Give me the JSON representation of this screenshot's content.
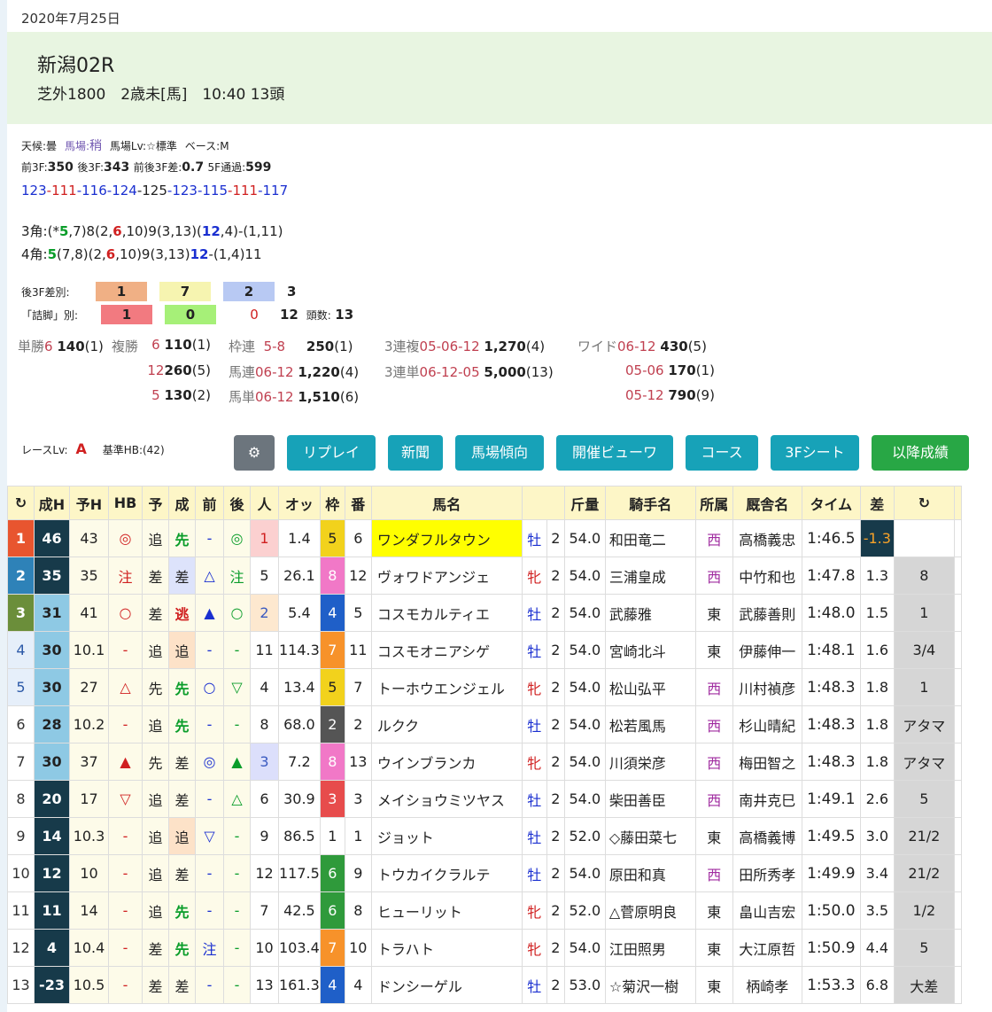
{
  "race": {
    "date": "2020年7月25日",
    "venue": "新潟02R",
    "conditions": "芝外1800　2歳未[馬]　10:40 13頭"
  },
  "track": {
    "weather": "天候:曇",
    "going_label": "馬場:",
    "going": "稍",
    "level": "馬場Lv:☆標準",
    "pace": "ベース:M",
    "front3f_label": "前3F:",
    "front3f": "350",
    "back3f_label": "後3F:",
    "back3f": "343",
    "diff_label": "前後3F差:",
    "diff": "0.7",
    "pass5f_label": "5F通過:",
    "pass5f": "599",
    "laps": [
      "123",
      "111",
      "116",
      "124",
      "125",
      "123",
      "115",
      "111",
      "117"
    ]
  },
  "corners": {
    "c3_prefix": "3角:(*",
    "c3_a": "5",
    "c3_b": ",7)8(2,",
    "c3_c": "6",
    "c3_d": ",10)9(3,13)(",
    "c3_e": "12",
    "c3_f": ",4)-(1,11)",
    "c4_prefix": "4角:",
    "c4_a": "5",
    "c4_b": "(7,8)(2,",
    "c4_c": "6",
    "c4_d": ",10)9(3,13)",
    "c4_e": "12",
    "c4_f": "-(1,4)11"
  },
  "splits": {
    "label1": "後3F差別:",
    "v1": "1",
    "v2": "7",
    "v3": "2",
    "v4": "3",
    "label2": "「詰脚」別:",
    "w1": "1",
    "w2": "0",
    "w3": "0",
    "w4": "12",
    "count_label": "頭数:",
    "count": "13"
  },
  "payouts": {
    "win_label": "単勝",
    "win_no": "6",
    "win_amt": "140",
    "win_pop": "(1)",
    "place_label": "複勝",
    "p1_no": "6",
    "p1_amt": "110",
    "p1_pop": "(1)",
    "p2_no": "12",
    "p2_amt": "260",
    "p2_pop": "(5)",
    "p3_no": "5",
    "p3_amt": "130",
    "p3_pop": "(2)",
    "wakuren_label": "枠連",
    "wakuren_no": "5-8",
    "wakuren_amt": "250",
    "wakuren_pop": "(1)",
    "umaren_label": "馬連",
    "umaren_no": "06-12",
    "umaren_amt": "1,220",
    "umaren_pop": "(4)",
    "umatan_label": "馬単",
    "umatan_no": "06-12",
    "umatan_amt": "1,510",
    "umatan_pop": "(6)",
    "trio_label": "3連複",
    "trio_no": "05-06-12",
    "trio_amt": "1,270",
    "trio_pop": "(4)",
    "tri_label": "3連単",
    "tri_no": "06-12-05",
    "tri_amt": "5,000",
    "tri_pop": "(13)",
    "wide_label": "ワイド",
    "w1_no": "06-12",
    "w1_amt": "430",
    "w1_pop": "(5)",
    "w2_no": "05-06",
    "w2_amt": "170",
    "w2_pop": "(1)",
    "w3_no": "05-12",
    "w3_amt": "790",
    "w3_pop": "(9)"
  },
  "level": {
    "label": "レースLv:",
    "value": "A",
    "hb_label": "基準HB:(42)"
  },
  "buttons": {
    "replay": "リプレイ",
    "paper": "新聞",
    "going": "馬場傾向",
    "view": "開催ビューワ",
    "course": "コース",
    "sheet": "3Fシート",
    "after": "以降成績"
  },
  "headers": [
    "成H",
    "予H",
    "HB",
    "予",
    "成",
    "前",
    "後",
    "人",
    "オッ",
    "枠",
    "番",
    "馬名",
    "",
    "斤量",
    "騎手名",
    "所属",
    "厩舎名",
    "タイム",
    "差"
  ],
  "rows": [
    [
      "1",
      "46",
      "43",
      "◎",
      "追",
      "先",
      "-",
      "◎",
      "1",
      "1.4",
      "5",
      "6",
      "ワンダフルタウン",
      "牡",
      "2",
      "54.0",
      "和田竜二",
      "西",
      "高橋義忠",
      "1:46.5",
      "-1.3",
      ""
    ],
    [
      "2",
      "35",
      "35",
      "注",
      "差",
      "差",
      "△",
      "注",
      "5",
      "26.1",
      "8",
      "12",
      "ヴォワドアンジェ",
      "牝",
      "2",
      "54.0",
      "三浦皇成",
      "西",
      "中竹和也",
      "1:47.8",
      "1.3",
      "8"
    ],
    [
      "3",
      "31",
      "41",
      "○",
      "差",
      "逃",
      "▲",
      "○",
      "2",
      "5.4",
      "4",
      "5",
      "コスモカルティエ",
      "牡",
      "2",
      "54.0",
      "武藤雅",
      "東",
      "武藤善則",
      "1:48.0",
      "1.5",
      "1"
    ],
    [
      "4",
      "30",
      "10.1",
      "-",
      "追",
      "追",
      "-",
      "-",
      "11",
      "114.3",
      "7",
      "11",
      "コスモオニアシゲ",
      "牡",
      "2",
      "54.0",
      "宮崎北斗",
      "東",
      "伊藤伸一",
      "1:48.1",
      "1.6",
      "3/4"
    ],
    [
      "5",
      "30",
      "27",
      "△",
      "先",
      "先",
      "○",
      "▽",
      "4",
      "13.4",
      "5",
      "7",
      "トーホウエンジェル",
      "牝",
      "2",
      "54.0",
      "松山弘平",
      "西",
      "川村禎彦",
      "1:48.3",
      "1.8",
      "1"
    ],
    [
      "6",
      "28",
      "10.2",
      "-",
      "追",
      "先",
      "-",
      "-",
      "8",
      "68.0",
      "2",
      "2",
      "ルクク",
      "牡",
      "2",
      "54.0",
      "松若風馬",
      "西",
      "杉山晴紀",
      "1:48.3",
      "1.8",
      "アタマ"
    ],
    [
      "7",
      "30",
      "37",
      "▲",
      "先",
      "差",
      "◎",
      "▲",
      "3",
      "7.2",
      "8",
      "13",
      "ウインブランカ",
      "牝",
      "2",
      "54.0",
      "川須栄彦",
      "西",
      "梅田智之",
      "1:48.3",
      "1.8",
      "アタマ"
    ],
    [
      "8",
      "20",
      "17",
      "▽",
      "追",
      "差",
      "-",
      "△",
      "6",
      "30.9",
      "3",
      "3",
      "メイショウミツヤス",
      "牡",
      "2",
      "54.0",
      "柴田善臣",
      "西",
      "南井克巳",
      "1:49.1",
      "2.6",
      "5"
    ],
    [
      "9",
      "14",
      "10.3",
      "-",
      "追",
      "追",
      "▽",
      "-",
      "9",
      "86.5",
      "1",
      "1",
      "ジョット",
      "牡",
      "2",
      "52.0",
      "◇藤田菜七",
      "東",
      "高橋義博",
      "1:49.5",
      "3.0",
      "21/2"
    ],
    [
      "10",
      "12",
      "10",
      "-",
      "追",
      "差",
      "-",
      "-",
      "12",
      "117.5",
      "6",
      "9",
      "トウカイクラルテ",
      "牡",
      "2",
      "54.0",
      "原田和真",
      "西",
      "田所秀孝",
      "1:49.9",
      "3.4",
      "21/2"
    ],
    [
      "11",
      "11",
      "14",
      "-",
      "追",
      "先",
      "-",
      "-",
      "7",
      "42.5",
      "6",
      "8",
      "ヒューリット",
      "牝",
      "2",
      "52.0",
      "△菅原明良",
      "東",
      "畠山吉宏",
      "1:50.0",
      "3.5",
      "1/2"
    ],
    [
      "12",
      "4",
      "10.4",
      "-",
      "差",
      "先",
      "注",
      "-",
      "10",
      "103.4",
      "7",
      "10",
      "トラハト",
      "牝",
      "2",
      "54.0",
      "江田照男",
      "東",
      "大江原哲",
      "1:50.9",
      "4.4",
      "5"
    ],
    [
      "13",
      "-23",
      "10.5",
      "-",
      "差",
      "差",
      "-",
      "-",
      "13",
      "161.3",
      "4",
      "4",
      "ドンシーゲル",
      "牡",
      "2",
      "53.0",
      "☆菊沢一樹",
      "東",
      "柄崎孝",
      "1:53.3",
      "6.8",
      "大差"
    ]
  ],
  "colors": {
    "waku1": "#ffffff",
    "waku2": "#555555",
    "waku3": "#e74c4c",
    "waku4": "#1f5fc8",
    "waku5": "#f2d21c",
    "waku6": "#2f9a3b",
    "waku7": "#f7922a",
    "waku8": "#f178c7"
  }
}
